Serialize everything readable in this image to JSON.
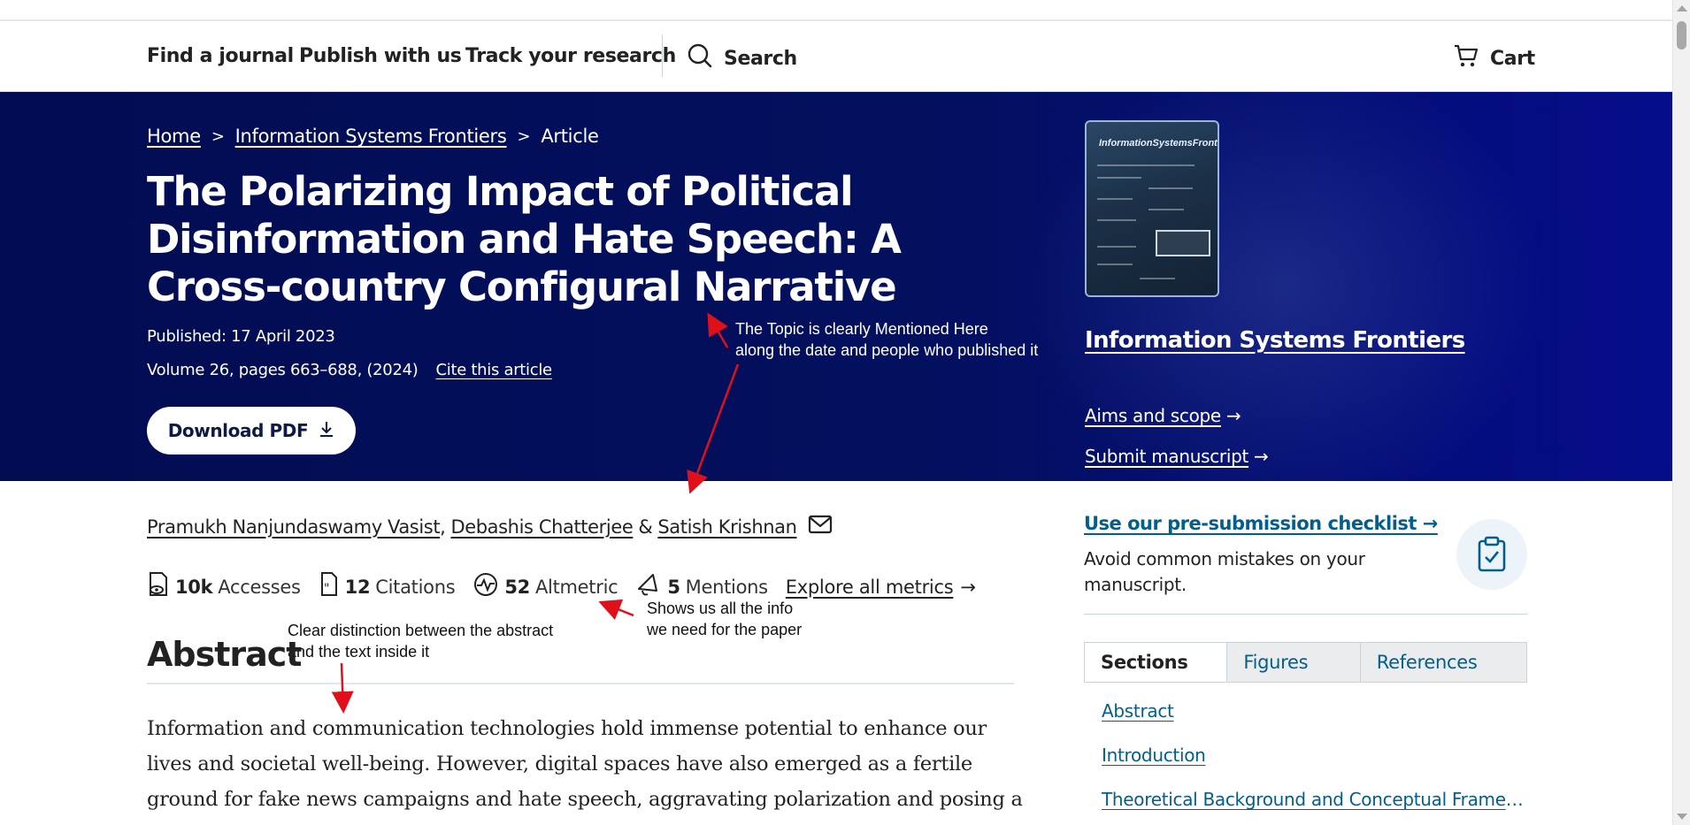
{
  "nav": {
    "find_journal": "Find a journal",
    "publish": "Publish with us",
    "track": "Track your research",
    "search": "Search",
    "cart": "Cart"
  },
  "breadcrumb": {
    "home": "Home",
    "journal": "Information Systems Frontiers",
    "current": "Article",
    "separator": ">"
  },
  "article": {
    "title": "The Polarizing Impact of Political Disinformation and Hate Speech: A Cross-country Configural Narrative",
    "published": "Published: 17 April 2023",
    "volume": "Volume 26, pages 663–688, (2024)",
    "cite": "Cite this article",
    "download": "Download PDF"
  },
  "journal_panel": {
    "name": "Information Systems Frontiers",
    "aims": "Aims and scope",
    "submit": "Submit manuscript",
    "arrow": "→"
  },
  "authors": {
    "a1": "Pramukh Nanjundaswamy Vasist",
    "comma1": ",",
    "a2": "Debashis Chatterjee",
    "amp": "&",
    "a3": "Satish Krishnan"
  },
  "metrics": {
    "accesses_value": "10k",
    "accesses_label": "Accesses",
    "citations_value": "12",
    "citations_label": "Citations",
    "altmetric_value": "52",
    "altmetric_label": "Altmetric",
    "mentions_value": "5",
    "mentions_label": "Mentions",
    "explore": "Explore all metrics",
    "arrow": "→"
  },
  "abstract": {
    "heading": "Abstract",
    "text": "Information and communication technologies hold immense potential to enhance our lives and societal well-being. However, digital spaces have also emerged as a fertile ground for fake news campaigns and hate speech, aggravating polarization and posing a threat to"
  },
  "sidebar": {
    "checklist_link": "Use our pre-submission checklist →",
    "checklist_text": "Avoid common mistakes on your manuscript.",
    "tabs": [
      "Sections",
      "Figures",
      "References"
    ],
    "toc": [
      "Abstract",
      "Introduction",
      "Theoretical Background and Conceptual Framew…"
    ]
  },
  "annotations": {
    "topic_line1": "The Topic is clearly Mentioned Here",
    "topic_line2": "along the date and people who published it",
    "metrics_line1": "Shows us all the info",
    "metrics_line2": "we need for the paper",
    "abstract_line1": "Clear distinction between the abstract",
    "abstract_line2": "and the text inside it"
  },
  "colors": {
    "hero_bg": "#03105e",
    "link_blue": "#025e8d",
    "annotation_arrow": "#e0101a"
  }
}
